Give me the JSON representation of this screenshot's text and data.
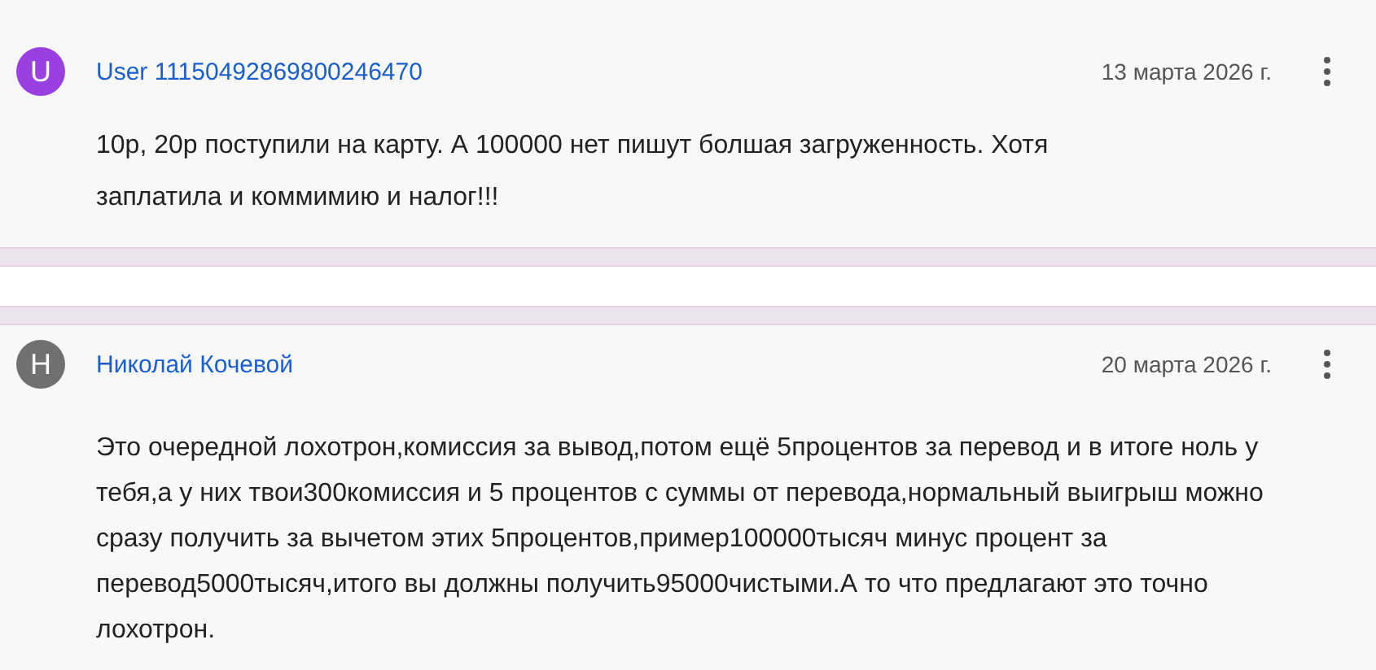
{
  "comments": [
    {
      "initial": "U",
      "color": "#9b40e0",
      "author": "User 11150492869800246470",
      "date": "13 марта 2026 г.",
      "text": "10р, 20р поступили на карту. А 100000 нет пишут болшая загруженность. Хотя заплатила и коммимию и налог!!!"
    },
    {
      "initial": "H",
      "color": "#707070",
      "author": "Николай Кочевой",
      "date": "20 марта 2026 г.",
      "text": "Это очередной лохотрон,комиссия за вывод,потом ещё 5процентов за перевод и в итоге ноль у тебя,а у них твои300комиссия и 5 процентов с суммы от перевода,нормальный выигрыш можно сразу получить за вычетом этих 5процентов,пример100000тысяч минус процент за перевод5000тысяч,итого вы должны получить95000чистыми.А то что предлагают это точно лохотрон."
    }
  ]
}
